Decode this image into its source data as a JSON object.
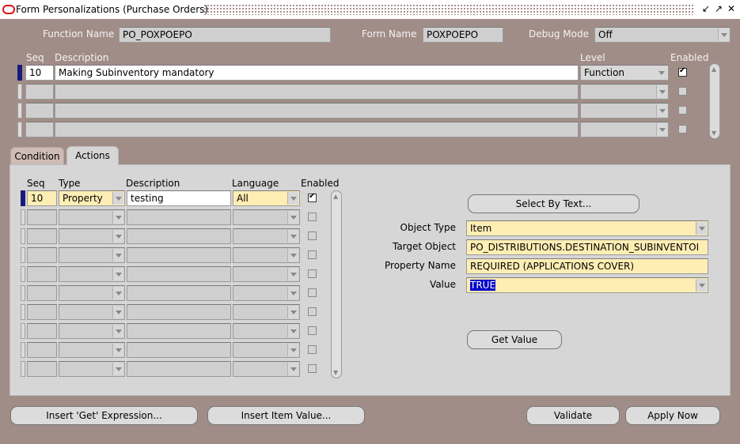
{
  "window": {
    "title": "Form Personalizations (Purchase Orders)",
    "controls": [
      "↙",
      "↗",
      "✕"
    ]
  },
  "header": {
    "function_name_label": "Function Name",
    "function_name_value": "PO_POXPOEPO",
    "form_name_label": "Form Name",
    "form_name_value": "POXPOEPO",
    "debug_mode_label": "Debug Mode",
    "debug_mode_value": "Off"
  },
  "rules": {
    "columns": {
      "seq": "Seq",
      "description": "Description",
      "level": "Level",
      "enabled": "Enabled"
    },
    "rows": [
      {
        "seq": "10",
        "description": "Making Subinventory mandatory",
        "level": "Function",
        "enabled": true
      },
      {
        "seq": "",
        "description": "",
        "level": "",
        "enabled": false
      },
      {
        "seq": "",
        "description": "",
        "level": "",
        "enabled": false
      },
      {
        "seq": "",
        "description": "",
        "level": "",
        "enabled": false
      }
    ]
  },
  "tabs": [
    {
      "label": "Condition",
      "active": false
    },
    {
      "label": "Actions",
      "active": true
    }
  ],
  "actions": {
    "columns": {
      "seq": "Seq",
      "type": "Type",
      "description": "Description",
      "language": "Language",
      "enabled": "Enabled"
    },
    "rows": [
      {
        "seq": "10",
        "type": "Property",
        "description": "testing",
        "language": "All",
        "enabled": true
      },
      {
        "seq": "",
        "type": "",
        "description": "",
        "language": "",
        "enabled": false
      },
      {
        "seq": "",
        "type": "",
        "description": "",
        "language": "",
        "enabled": false
      },
      {
        "seq": "",
        "type": "",
        "description": "",
        "language": "",
        "enabled": false
      },
      {
        "seq": "",
        "type": "",
        "description": "",
        "language": "",
        "enabled": false
      },
      {
        "seq": "",
        "type": "",
        "description": "",
        "language": "",
        "enabled": false
      },
      {
        "seq": "",
        "type": "",
        "description": "",
        "language": "",
        "enabled": false
      },
      {
        "seq": "",
        "type": "",
        "description": "",
        "language": "",
        "enabled": false
      },
      {
        "seq": "",
        "type": "",
        "description": "",
        "language": "",
        "enabled": false
      },
      {
        "seq": "",
        "type": "",
        "description": "",
        "language": "",
        "enabled": false
      }
    ]
  },
  "property": {
    "select_by_text": "Select By Text...",
    "object_type_label": "Object Type",
    "object_type_value": "Item",
    "target_object_label": "Target Object",
    "target_object_value": "PO_DISTRIBUTIONS.DESTINATION_SUBINVENTOI",
    "property_name_label": "Property Name",
    "property_name_value": "REQUIRED (APPLICATIONS COVER)",
    "value_label": "Value",
    "value_value": "TRUE",
    "get_value": "Get Value"
  },
  "buttons": {
    "insert_get_expression": "Insert 'Get' Expression...",
    "insert_item_value": "Insert Item Value...",
    "validate": "Validate",
    "apply_now": "Apply Now"
  },
  "colors": {
    "background": "#a18d87",
    "panel": "#d6d6d6",
    "required_field": "#ffeeb4",
    "selection": "#0000c8",
    "title_icon": "#e01010"
  }
}
